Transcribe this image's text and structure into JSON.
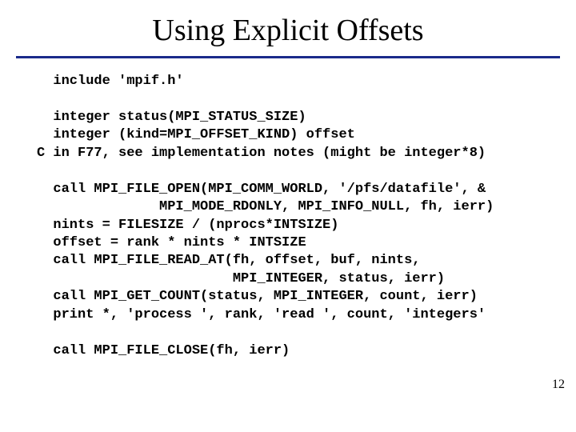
{
  "title": "Using Explicit Offsets",
  "code": {
    "l01": "  include 'mpif.h'",
    "l02": "",
    "l03": "  integer status(MPI_STATUS_SIZE)",
    "l04": "  integer (kind=MPI_OFFSET_KIND) offset",
    "l05": "C in F77, see implementation notes (might be integer*8)",
    "l06": "",
    "l07": "  call MPI_FILE_OPEN(MPI_COMM_WORLD, '/pfs/datafile', &",
    "l08": "               MPI_MODE_RDONLY, MPI_INFO_NULL, fh, ierr)",
    "l09": "  nints = FILESIZE / (nprocs*INTSIZE)",
    "l10": "  offset = rank * nints * INTSIZE",
    "l11": "  call MPI_FILE_READ_AT(fh, offset, buf, nints,",
    "l12": "                        MPI_INTEGER, status, ierr)",
    "l13": "  call MPI_GET_COUNT(status, MPI_INTEGER, count, ierr)",
    "l14": "  print *, 'process ', rank, 'read ', count, 'integers'",
    "l15": "",
    "l16": "  call MPI_FILE_CLOSE(fh, ierr)"
  },
  "pagenum": "12"
}
